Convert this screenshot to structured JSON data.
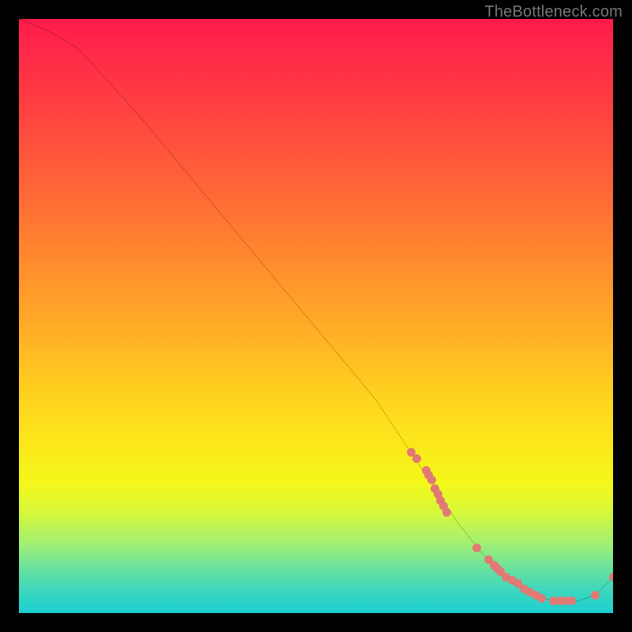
{
  "watermark": "TheBottleneck.com",
  "chart_data": {
    "type": "line",
    "title": "",
    "xlabel": "",
    "ylabel": "",
    "xlim": [
      0,
      100
    ],
    "ylim": [
      0,
      100
    ],
    "grid": false,
    "series": [
      {
        "name": "bottleneck-curve",
        "x": [
          0,
          5,
          10,
          20,
          30,
          40,
          50,
          60,
          66,
          70,
          74,
          78,
          82,
          86,
          90,
          94,
          97,
          100
        ],
        "y": [
          100,
          98,
          95,
          84,
          72,
          60,
          48,
          36,
          27,
          21,
          15,
          10,
          6,
          3,
          2,
          2,
          3,
          6
        ]
      }
    ],
    "markers": {
      "name": "highlight-points",
      "x": [
        66,
        67,
        68.5,
        69,
        69.5,
        70,
        70.5,
        71,
        71.5,
        72,
        77,
        79,
        80,
        80.5,
        81,
        82,
        83,
        84,
        85,
        86,
        87,
        88,
        90,
        91,
        92,
        93,
        97,
        100
      ],
      "y": [
        27,
        26,
        24,
        23.2,
        22.4,
        21,
        20,
        19,
        18,
        17,
        11,
        9,
        8,
        7.5,
        7,
        6,
        5.5,
        5,
        4,
        3.5,
        3,
        2.5,
        2,
        2,
        2,
        2,
        3,
        6
      ]
    }
  },
  "colors": {
    "curve_stroke": "#000000",
    "marker_fill": "#e17a74",
    "watermark_text": "#777777",
    "page_bg": "#000000"
  }
}
